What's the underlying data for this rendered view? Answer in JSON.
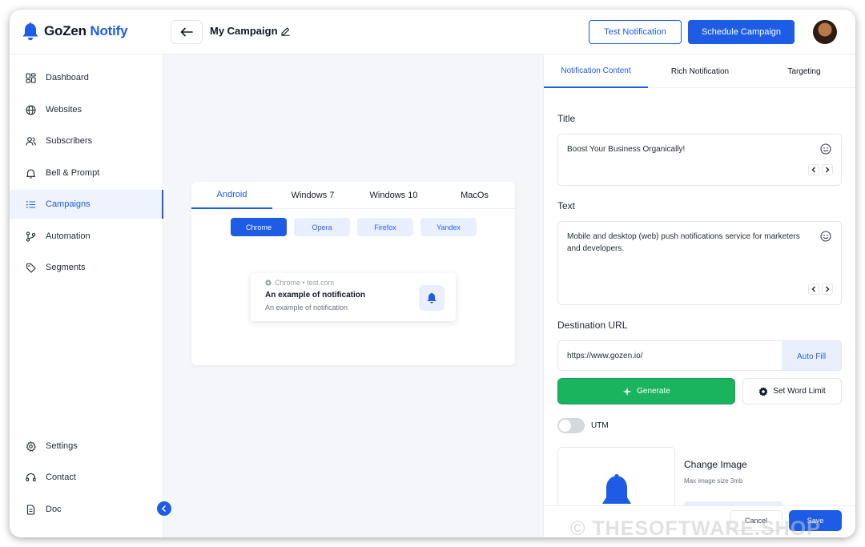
{
  "app": {
    "name_part1": "GoZen",
    "name_part2": " Notify"
  },
  "header": {
    "campaign_name": "My Campaign",
    "test_button": "Test Notification",
    "schedule_button": "Schedule Campaign"
  },
  "sidebar": {
    "items": [
      {
        "label": "Dashboard",
        "icon": "dashboard-icon"
      },
      {
        "label": "Websites",
        "icon": "globe-icon"
      },
      {
        "label": "Subscribers",
        "icon": "users-icon"
      },
      {
        "label": "Bell & Prompt",
        "icon": "bell-icon"
      },
      {
        "label": "Campaigns",
        "icon": "list-icon",
        "active": true
      },
      {
        "label": "Automation",
        "icon": "branch-icon"
      },
      {
        "label": "Segments",
        "icon": "tag-icon"
      }
    ],
    "bottom_items": [
      {
        "label": "Settings",
        "icon": "gear-icon"
      },
      {
        "label": "Contact",
        "icon": "headset-icon"
      },
      {
        "label": "Doc",
        "icon": "document-icon"
      }
    ]
  },
  "preview": {
    "os_tabs": [
      "Android",
      "Windows 7",
      "Windows 10",
      "MacOs"
    ],
    "active_os": "Android",
    "browsers": [
      "Chrome",
      "Opera",
      "Firefox",
      "Yandex"
    ],
    "active_browser": "Chrome",
    "notification": {
      "source": "Chrome • test.com",
      "title": "An example of notification",
      "text": "An example of notification"
    }
  },
  "panel": {
    "tabs": [
      "Notification Content",
      "Rich Notification",
      "Targeting"
    ],
    "active_tab": "Notification Content",
    "title_label": "Title",
    "title_value": "Boost Your Business Organically!",
    "text_label": "Text",
    "text_value": "Mobile and desktop (web) push notifications service for marketers and developers.",
    "url_label": "Destination URL",
    "url_value": "https://www.gozen.io/",
    "autofill_label": "Auto Fill",
    "generate_label": "Generate",
    "word_limit_label": "Set Word Limit",
    "utm_label": "UTM",
    "utm_enabled": false,
    "change_image_label": "Change Image",
    "max_image_size": "Max image size 3mb",
    "cancel_label": "Cancel",
    "save_label": "Save"
  },
  "watermark": "© THESOFTWARE.SHOP",
  "colors": {
    "accent": "#1e5ce6",
    "generate": "#1ab35e",
    "background": "#f4f6f9"
  }
}
